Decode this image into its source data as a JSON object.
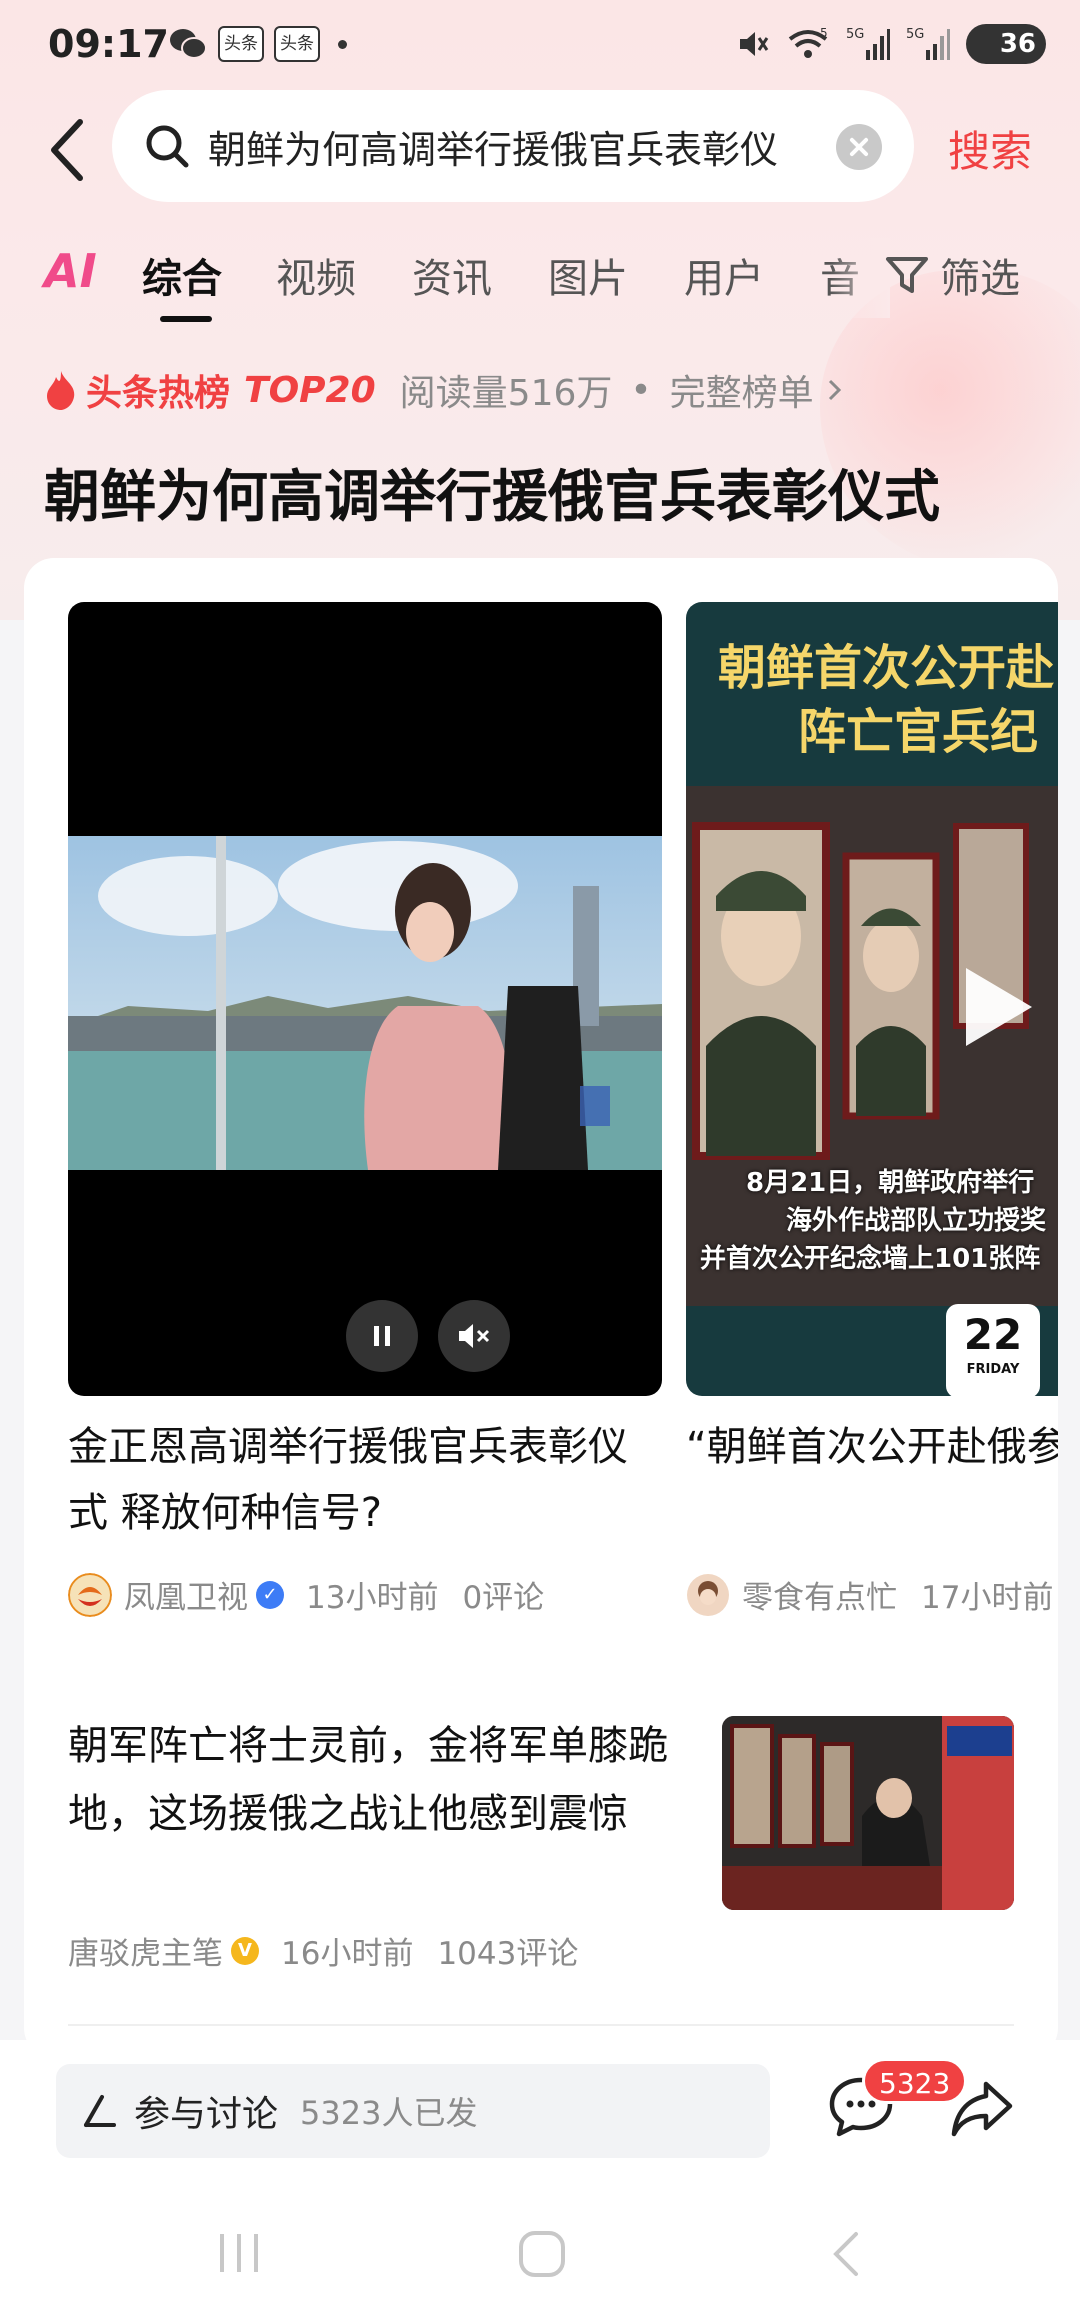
{
  "status_bar": {
    "time": "09:17",
    "app_badges": [
      "头条",
      "头条"
    ],
    "battery": "36",
    "network_labels": [
      "5",
      "5G",
      "5G"
    ]
  },
  "search": {
    "query": "朝鲜为何高调举行援俄官兵表彰仪",
    "button_label": "搜索"
  },
  "tabs": {
    "ai_label": "AI",
    "items": [
      {
        "label": "综合",
        "active": true
      },
      {
        "label": "视频",
        "active": false
      },
      {
        "label": "资讯",
        "active": false
      },
      {
        "label": "图片",
        "active": false
      },
      {
        "label": "用户",
        "active": false
      },
      {
        "label": "音",
        "active": false
      }
    ],
    "filter_label": "筛选"
  },
  "hot_rank": {
    "label": "头条热榜",
    "rank": "TOP20",
    "reads": "阅读量516万",
    "separator": "•",
    "full_list": "完整榜单"
  },
  "headline": "朝鲜为何高调举行援俄官兵表彰仪式",
  "videos": [
    {
      "title": "金正恩高调举行援俄官兵表彰仪式 释放何种信号?",
      "author": "凤凰卫视",
      "time": "13小时前",
      "comments": "0评论",
      "playing": true
    },
    {
      "overlay_title_line1": "朝鲜首次公开赴",
      "overlay_title_line2": "阵亡官兵纪",
      "caption_line1": "8月21日，朝鲜政府举行",
      "caption_line2": "海外作战部队立功授奖",
      "caption_line3": "并首次公开纪念墙上101张阵",
      "date_num": "22",
      "date_day": "FRIDAY",
      "title": "“朝鲜首次公开赴俄参战阵亡官兵纪念墙”!",
      "author": "零食有点忙",
      "time": "17小时前"
    }
  ],
  "article": {
    "title": "朝军阵亡将士灵前，金将军单膝跪地，这场援俄之战让他感到震惊",
    "author": "唐驳虎主笔",
    "time": "16小时前",
    "comments": "1043评论"
  },
  "bottom_bar": {
    "discuss_label": "参与讨论",
    "discuss_count": "5323人已发",
    "comment_badge": "5323"
  },
  "colors": {
    "accent_red": "#f04142",
    "verified_blue": "#3d7cf6",
    "verified_gold": "#f5b71d"
  }
}
